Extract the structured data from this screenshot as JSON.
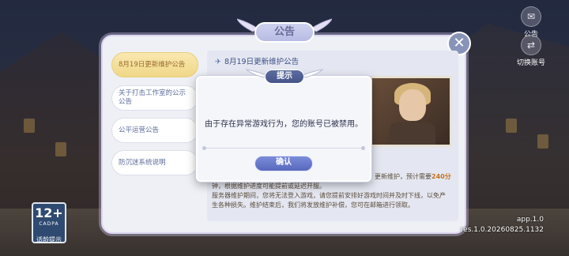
{
  "top_right": {
    "announce_label": "公告",
    "switch_label": "切换账号"
  },
  "age_badge": {
    "age": "12+",
    "org": "CADPA",
    "label": "适龄提示"
  },
  "version": {
    "app": "app.1.0",
    "res": "res.1.0.20260825.1132"
  },
  "panel": {
    "title": "公告",
    "close": "✕",
    "tabs": [
      {
        "label": "8月19日更新维护公告",
        "active": true
      },
      {
        "label": "关于打击工作室的公示公告",
        "active": false
      },
      {
        "label": "公平运营公告",
        "active": false
      },
      {
        "label": "防沉迷系统说明",
        "active": false
      }
    ],
    "content_title": "8月19日更新维护公告",
    "notice_right_prefix": "更新维护，预计需要",
    "notice_right_highlight": "240分",
    "body_lines": [
      "钟，根据维护进度可能提前或延迟开服。",
      "服务器维护期间，您将无法登入游戏，请您提前安排好游戏时间并及时下线，以免产",
      "生各种损失。维护结束后，我们将发放维护补偿，您可在邮箱进行领取。"
    ]
  },
  "modal": {
    "title": "提示",
    "message": "由于存在异常游戏行为，您的账号已被禁用。",
    "confirm": "确认"
  }
}
